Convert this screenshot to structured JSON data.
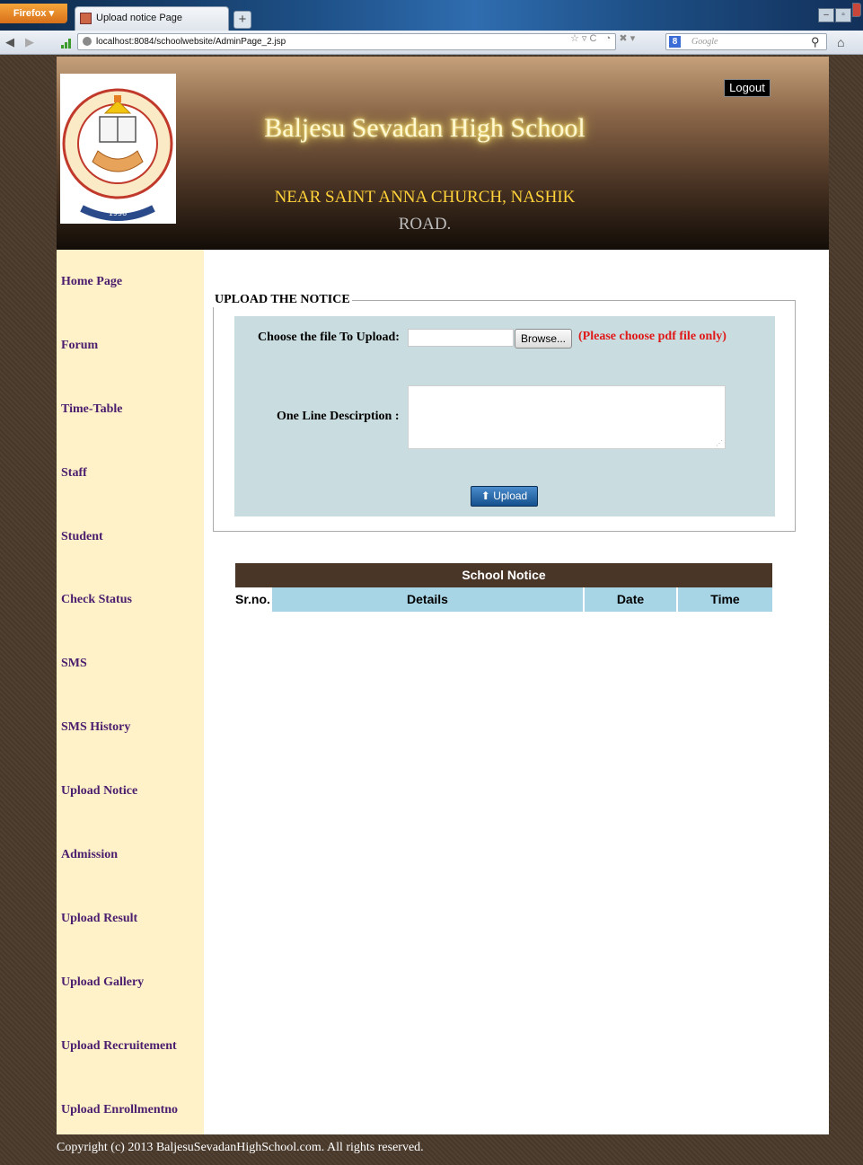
{
  "browser": {
    "app_button": "Firefox",
    "tab_title": "Upload notice Page",
    "new_tab": "+",
    "url": "localhost:8084/schoolwebsite/AdminPage_2.jsp",
    "search_placeholder": "Google",
    "window_controls": [
      "–",
      "▫",
      ""
    ]
  },
  "header": {
    "school_name": "Baljesu Sevadan High School",
    "address_line": "NEAR SAINT ANNA CHURCH, NASHIK",
    "address_road": "ROAD.",
    "logout_label": "Logout",
    "logo_year": "1958"
  },
  "sidebar": {
    "items": [
      {
        "label": "Home Page"
      },
      {
        "label": "Forum"
      },
      {
        "label": "Time-Table"
      },
      {
        "label": "Staff"
      },
      {
        "label": "Student"
      },
      {
        "label": "Check Status"
      },
      {
        "label": "SMS"
      },
      {
        "label": "SMS History"
      },
      {
        "label": "Upload Notice"
      },
      {
        "label": "Admission"
      },
      {
        "label": "Upload Result"
      },
      {
        "label": "Upload Gallery"
      },
      {
        "label": "Upload Recruitement"
      },
      {
        "label": "Upload Enrollmentno"
      }
    ]
  },
  "upload_form": {
    "legend": "UPLOAD THE NOTICE",
    "file_label": "Choose the file To Upload:",
    "browse_label": "Browse...",
    "pdf_note": "(Please choose pdf file only)",
    "description_label": "One Line Descirption :",
    "upload_label": "Upload"
  },
  "notice_table": {
    "title": "School Notice",
    "columns": [
      "Sr.no.",
      "Details",
      "Date",
      "Time"
    ]
  },
  "footer": {
    "copyright": "Copyright (c) 2013 BaljesuSevadanHighSchool.com. All rights reserved."
  },
  "colors": {
    "sidebar_bg": "#fff2c8",
    "sidebar_text": "#4b1d6e",
    "form_panel_bg": "#c9dcdf",
    "table_title_bg": "#4a3627",
    "table_head_bg": "#a7d5e6",
    "warning_text": "#e01818"
  }
}
